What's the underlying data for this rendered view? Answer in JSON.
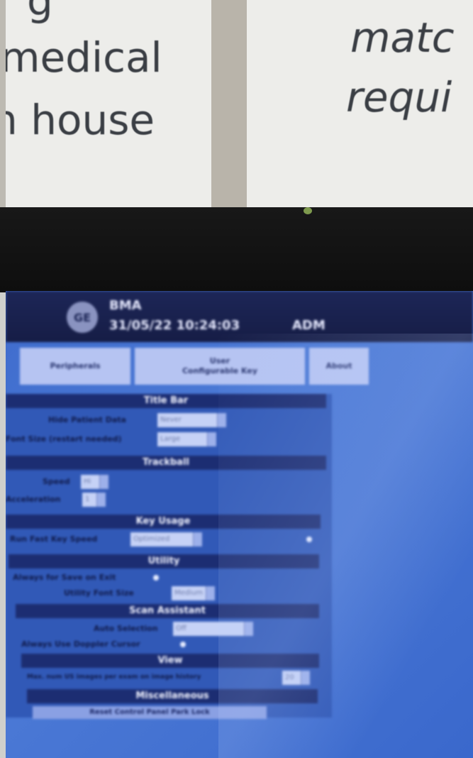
{
  "signage": {
    "left_lines": [
      "g",
      "medical",
      "n house"
    ],
    "right_lines": [
      "matc",
      "requi"
    ]
  },
  "header": {
    "logo_text": "GE",
    "institution": "BMA",
    "datetime": "31/05/22 10:24:03",
    "user": "ADM"
  },
  "tabs": [
    {
      "label": "Peripherals"
    },
    {
      "label": "User\nConfigurable Key"
    },
    {
      "label": "About"
    }
  ],
  "sections": {
    "title_bar": {
      "title": "Title Bar",
      "hide_patient_data_label": "Hide Patient Data",
      "hide_patient_data_value": "Never",
      "font_size_label": "Font Size (restart needed)",
      "font_size_value": "Large"
    },
    "trackball": {
      "title": "Trackball",
      "speed_label": "Speed",
      "speed_value": "Hi",
      "acceleration_label": "Acceleration",
      "acceleration_value": "1"
    },
    "key_usage": {
      "title": "Key Usage",
      "run_fast_key_speed_label": "Run Fast Key Speed",
      "run_fast_key_speed_value": "Optimized"
    },
    "utility": {
      "title": "Utility",
      "always_save_label": "Always for Save on Exit",
      "font_size_label": "Utility Font Size",
      "font_size_value": "Medium"
    },
    "scan_assistant": {
      "title": "Scan Assistant",
      "auto_selection_label": "Auto Selection",
      "auto_selection_value": "Off",
      "always_doppler_label": "Always Use Doppler Cursor"
    },
    "view": {
      "title": "View",
      "max_images_label": "Max. num US images per exam on image history",
      "max_images_value": "20"
    },
    "miscellaneous": {
      "title": "Miscellaneous",
      "reset_button_label": "Reset Control Panel Park Lock"
    }
  }
}
